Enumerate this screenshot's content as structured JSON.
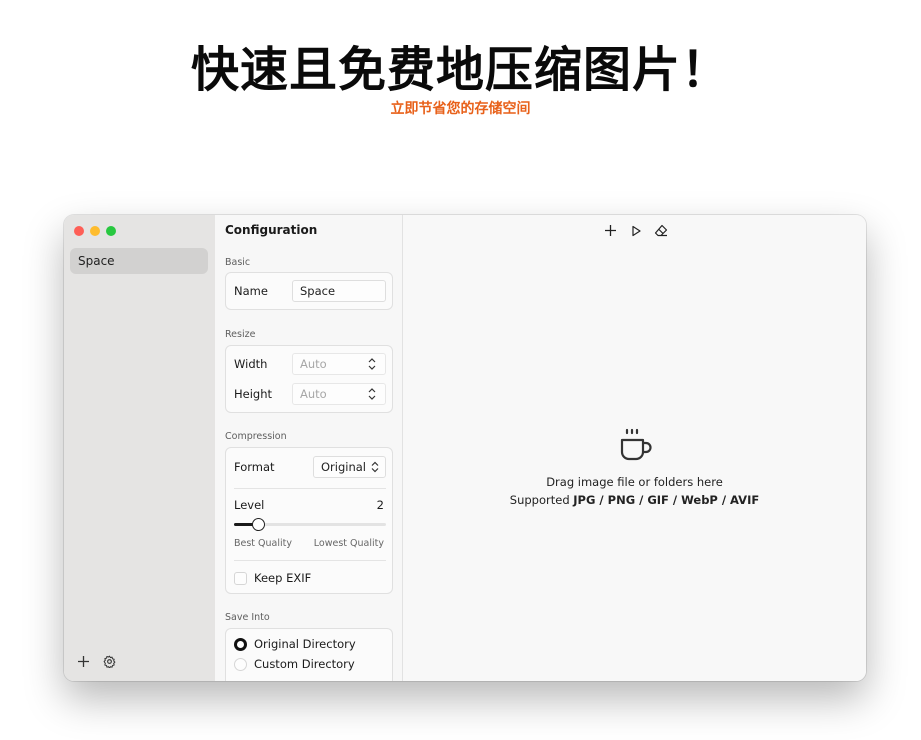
{
  "hero": {
    "title": "快速且免费地压缩图片！",
    "subtitle": "立即节省您的存储空间",
    "subtitle_color": "#e8611a"
  },
  "sidebar": {
    "items": [
      {
        "label": "Space",
        "selected": true
      }
    ],
    "add_icon": "plus-icon",
    "settings_icon": "gear-icon"
  },
  "config": {
    "title": "Configuration",
    "basic": {
      "label": "Basic",
      "name_label": "Name",
      "name_value": "Space"
    },
    "resize": {
      "label": "Resize",
      "width_label": "Width",
      "width_placeholder": "Auto",
      "height_label": "Height",
      "height_placeholder": "Auto"
    },
    "compression": {
      "label": "Compression",
      "format_label": "Format",
      "format_value": "Original",
      "level_label": "Level",
      "level_value": "2",
      "level_fraction": 0.16,
      "best_label": "Best Quality",
      "lowest_label": "Lowest Quality",
      "keep_exif_label": "Keep EXIF",
      "keep_exif_checked": false
    },
    "save_into": {
      "label": "Save Into",
      "options": [
        {
          "label": "Original Directory",
          "selected": true
        },
        {
          "label": "Custom Directory",
          "selected": false
        }
      ]
    }
  },
  "main": {
    "toolbar_icons": [
      "plus-icon",
      "play-icon",
      "eraser-icon"
    ],
    "drop_icon": "coffee-cup-icon",
    "drop_text": "Drag image file or folders here",
    "supported_prefix": "Supported ",
    "supported_formats": "JPG / PNG / GIF / WebP / AVIF"
  },
  "colors": {
    "traffic_red": "#fe5f57",
    "traffic_yellow": "#febc2e",
    "traffic_green": "#28c840",
    "sidebar_bg": "#e5e4e3"
  }
}
